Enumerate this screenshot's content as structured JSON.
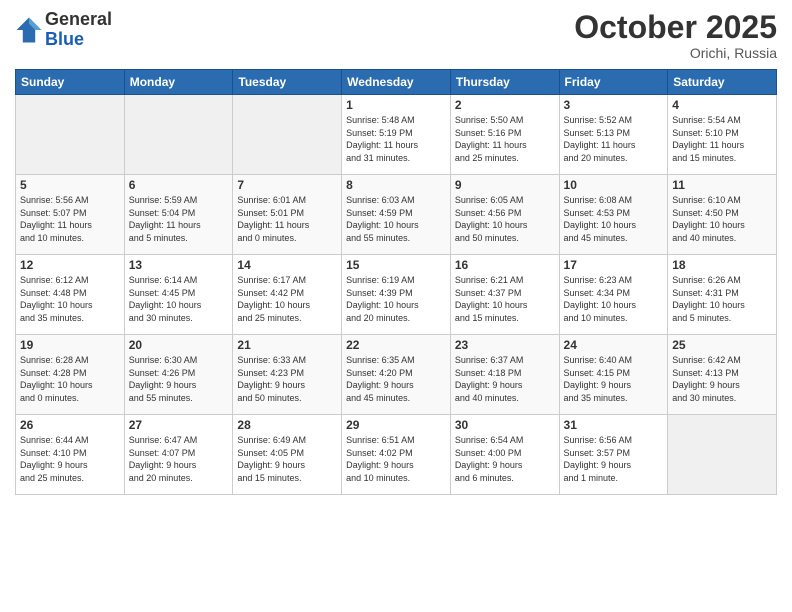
{
  "header": {
    "logo_line1": "General",
    "logo_line2": "Blue",
    "month": "October 2025",
    "location": "Orichi, Russia"
  },
  "days_of_week": [
    "Sunday",
    "Monday",
    "Tuesday",
    "Wednesday",
    "Thursday",
    "Friday",
    "Saturday"
  ],
  "weeks": [
    [
      {
        "day": "",
        "info": ""
      },
      {
        "day": "",
        "info": ""
      },
      {
        "day": "",
        "info": ""
      },
      {
        "day": "1",
        "info": "Sunrise: 5:48 AM\nSunset: 5:19 PM\nDaylight: 11 hours\nand 31 minutes."
      },
      {
        "day": "2",
        "info": "Sunrise: 5:50 AM\nSunset: 5:16 PM\nDaylight: 11 hours\nand 25 minutes."
      },
      {
        "day": "3",
        "info": "Sunrise: 5:52 AM\nSunset: 5:13 PM\nDaylight: 11 hours\nand 20 minutes."
      },
      {
        "day": "4",
        "info": "Sunrise: 5:54 AM\nSunset: 5:10 PM\nDaylight: 11 hours\nand 15 minutes."
      }
    ],
    [
      {
        "day": "5",
        "info": "Sunrise: 5:56 AM\nSunset: 5:07 PM\nDaylight: 11 hours\nand 10 minutes."
      },
      {
        "day": "6",
        "info": "Sunrise: 5:59 AM\nSunset: 5:04 PM\nDaylight: 11 hours\nand 5 minutes."
      },
      {
        "day": "7",
        "info": "Sunrise: 6:01 AM\nSunset: 5:01 PM\nDaylight: 11 hours\nand 0 minutes."
      },
      {
        "day": "8",
        "info": "Sunrise: 6:03 AM\nSunset: 4:59 PM\nDaylight: 10 hours\nand 55 minutes."
      },
      {
        "day": "9",
        "info": "Sunrise: 6:05 AM\nSunset: 4:56 PM\nDaylight: 10 hours\nand 50 minutes."
      },
      {
        "day": "10",
        "info": "Sunrise: 6:08 AM\nSunset: 4:53 PM\nDaylight: 10 hours\nand 45 minutes."
      },
      {
        "day": "11",
        "info": "Sunrise: 6:10 AM\nSunset: 4:50 PM\nDaylight: 10 hours\nand 40 minutes."
      }
    ],
    [
      {
        "day": "12",
        "info": "Sunrise: 6:12 AM\nSunset: 4:48 PM\nDaylight: 10 hours\nand 35 minutes."
      },
      {
        "day": "13",
        "info": "Sunrise: 6:14 AM\nSunset: 4:45 PM\nDaylight: 10 hours\nand 30 minutes."
      },
      {
        "day": "14",
        "info": "Sunrise: 6:17 AM\nSunset: 4:42 PM\nDaylight: 10 hours\nand 25 minutes."
      },
      {
        "day": "15",
        "info": "Sunrise: 6:19 AM\nSunset: 4:39 PM\nDaylight: 10 hours\nand 20 minutes."
      },
      {
        "day": "16",
        "info": "Sunrise: 6:21 AM\nSunset: 4:37 PM\nDaylight: 10 hours\nand 15 minutes."
      },
      {
        "day": "17",
        "info": "Sunrise: 6:23 AM\nSunset: 4:34 PM\nDaylight: 10 hours\nand 10 minutes."
      },
      {
        "day": "18",
        "info": "Sunrise: 6:26 AM\nSunset: 4:31 PM\nDaylight: 10 hours\nand 5 minutes."
      }
    ],
    [
      {
        "day": "19",
        "info": "Sunrise: 6:28 AM\nSunset: 4:28 PM\nDaylight: 10 hours\nand 0 minutes."
      },
      {
        "day": "20",
        "info": "Sunrise: 6:30 AM\nSunset: 4:26 PM\nDaylight: 9 hours\nand 55 minutes."
      },
      {
        "day": "21",
        "info": "Sunrise: 6:33 AM\nSunset: 4:23 PM\nDaylight: 9 hours\nand 50 minutes."
      },
      {
        "day": "22",
        "info": "Sunrise: 6:35 AM\nSunset: 4:20 PM\nDaylight: 9 hours\nand 45 minutes."
      },
      {
        "day": "23",
        "info": "Sunrise: 6:37 AM\nSunset: 4:18 PM\nDaylight: 9 hours\nand 40 minutes."
      },
      {
        "day": "24",
        "info": "Sunrise: 6:40 AM\nSunset: 4:15 PM\nDaylight: 9 hours\nand 35 minutes."
      },
      {
        "day": "25",
        "info": "Sunrise: 6:42 AM\nSunset: 4:13 PM\nDaylight: 9 hours\nand 30 minutes."
      }
    ],
    [
      {
        "day": "26",
        "info": "Sunrise: 6:44 AM\nSunset: 4:10 PM\nDaylight: 9 hours\nand 25 minutes."
      },
      {
        "day": "27",
        "info": "Sunrise: 6:47 AM\nSunset: 4:07 PM\nDaylight: 9 hours\nand 20 minutes."
      },
      {
        "day": "28",
        "info": "Sunrise: 6:49 AM\nSunset: 4:05 PM\nDaylight: 9 hours\nand 15 minutes."
      },
      {
        "day": "29",
        "info": "Sunrise: 6:51 AM\nSunset: 4:02 PM\nDaylight: 9 hours\nand 10 minutes."
      },
      {
        "day": "30",
        "info": "Sunrise: 6:54 AM\nSunset: 4:00 PM\nDaylight: 9 hours\nand 6 minutes."
      },
      {
        "day": "31",
        "info": "Sunrise: 6:56 AM\nSunset: 3:57 PM\nDaylight: 9 hours\nand 1 minute."
      },
      {
        "day": "",
        "info": ""
      }
    ]
  ]
}
